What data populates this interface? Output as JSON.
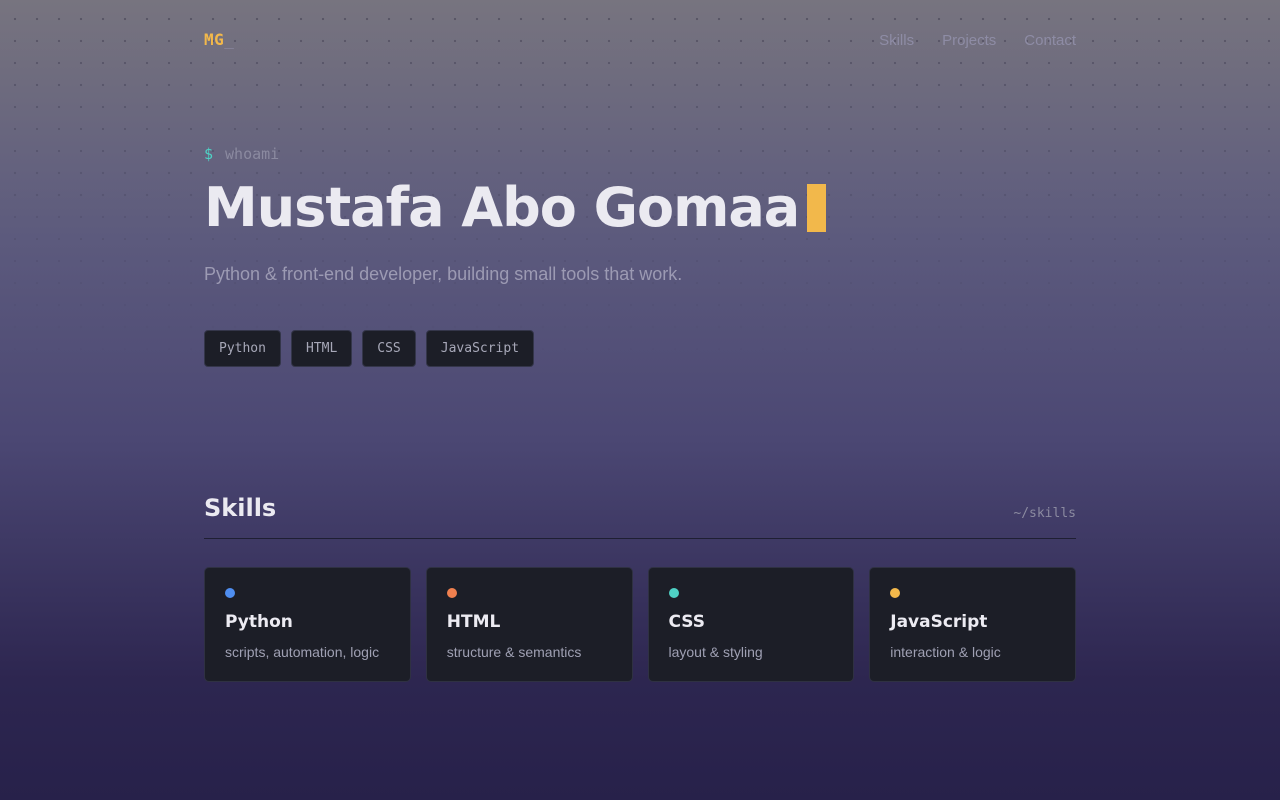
{
  "header": {
    "logo_text": "MG",
    "logo_cursor": "_",
    "nav": [
      "Skills",
      "Projects",
      "Contact"
    ]
  },
  "hero": {
    "prompt_symbol": "$",
    "prompt_command": "whoami",
    "name": "Mustafa Abo Gomaa",
    "tagline": "Python & front-end developer, building small tools that work.",
    "chips": [
      "Python",
      "HTML",
      "CSS",
      "JavaScript"
    ]
  },
  "skills": {
    "title": "Skills",
    "path": "~/skills",
    "cards": [
      {
        "title": "Python",
        "desc": "scripts, automation, logic",
        "color": "#4f8ef0"
      },
      {
        "title": "HTML",
        "desc": "structure & semantics",
        "color": "#f0804f"
      },
      {
        "title": "CSS",
        "desc": "layout & styling",
        "color": "#4fd1c5"
      },
      {
        "title": "JavaScript",
        "desc": "interaction & logic",
        "color": "#f2b84b"
      }
    ]
  },
  "colors": {
    "accent": "#f2b84b",
    "prompt": "#4fd1c5"
  }
}
